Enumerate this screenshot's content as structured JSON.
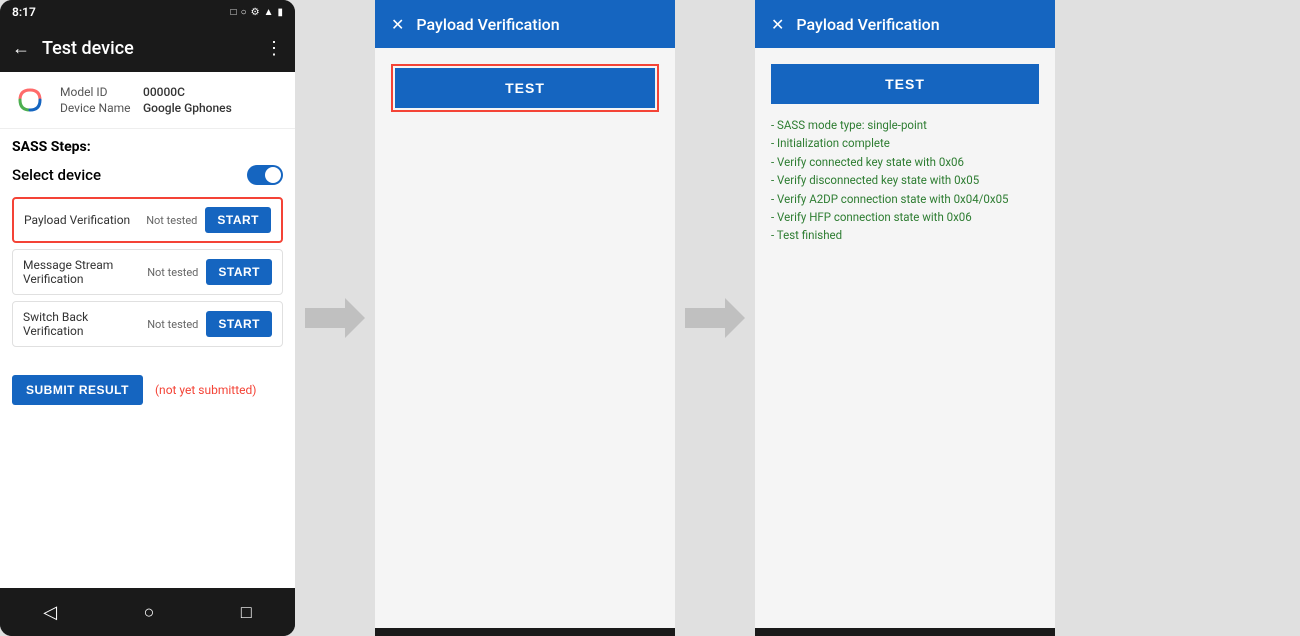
{
  "phone": {
    "status_bar": {
      "time": "8:17",
      "icons": "□ ○ ◁"
    },
    "app_bar": {
      "title": "Test device",
      "back_icon": "←",
      "menu_icon": "⋮"
    },
    "device_info": {
      "model_label": "Model ID",
      "model_value": "00000C",
      "name_label": "Device Name",
      "name_value": "Google Gphones"
    },
    "sass_title": "SASS Steps:",
    "select_device_label": "Select device",
    "steps": [
      {
        "name": "Payload Verification",
        "status": "Not tested",
        "button_label": "START",
        "highlighted": true
      },
      {
        "name": "Message Stream Verification",
        "status": "Not tested",
        "button_label": "START",
        "highlighted": false
      },
      {
        "name": "Switch Back Verification",
        "status": "Not tested",
        "button_label": "START",
        "highlighted": false
      }
    ],
    "submit_btn_label": "SUBMIT RESULT",
    "submit_status": "(not yet submitted)"
  },
  "dialog1": {
    "title": "Payload Verification",
    "close_icon": "✕",
    "test_btn_label": "TEST",
    "has_highlight": true
  },
  "dialog2": {
    "title": "Payload Verification",
    "close_icon": "✕",
    "test_btn_label": "TEST",
    "has_highlight": false,
    "result_lines": [
      "- SASS mode type: single-point",
      "- Initialization complete",
      "- Verify connected key state with 0x06",
      "- Verify disconnected key state with 0x05",
      "- Verify A2DP connection state with 0x04/0x05",
      "- Verify HFP connection state with 0x06",
      "- Test finished"
    ]
  }
}
